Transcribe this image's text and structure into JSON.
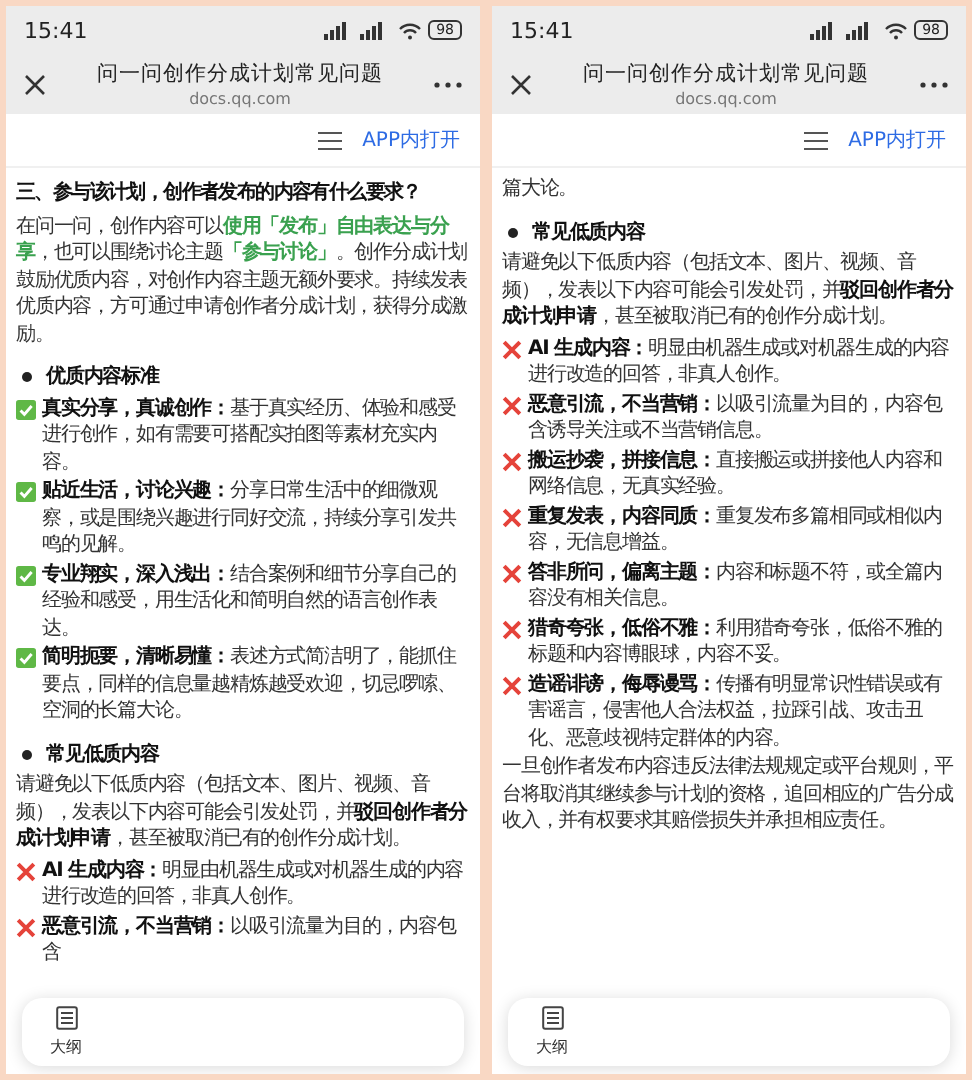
{
  "screens": [
    {
      "status_bar": {
        "time": "15:41",
        "battery": "98"
      },
      "header": {
        "title": "问一问创作分成计划常见问题",
        "url": "docs.qq.com"
      },
      "toolbar": {
        "open_in_app": "APP内打开"
      },
      "blocks": [
        {
          "kind": "heading",
          "text": "三、参与该计划，创作者发布的内容有什么要求？"
        },
        {
          "kind": "paragraph",
          "highlight": true,
          "text": "在问一问，创作内容可以**使用「发布」自由表达与分享**，也可以围绕讨论主题**「参与讨论」**。创作分成计划鼓励优质内容，对创作内容主题无额外要求。持续发表优质内容，方可通过申请创作者分成计划，获得分成激励。"
        },
        {
          "kind": "bullet",
          "text": "优质内容标准"
        },
        {
          "kind": "check",
          "text": "**真实分享，真诚创作：**基于真实经历、体验和感受进行创作，如有需要可搭配实拍图等素材充实内容。"
        },
        {
          "kind": "check",
          "text": "**贴近生活，讨论兴趣：**分享日常生活中的细微观察，或是围绕兴趣进行同好交流，持续分享引发共鸣的见解。"
        },
        {
          "kind": "check",
          "text": "**专业翔实，深入浅出：**结合案例和细节分享自己的经验和感受，用生活化和简明自然的语言创作表达。"
        },
        {
          "kind": "check",
          "text": "**简明扼要，清晰易懂：**表述方式简洁明了，能抓住要点，同样的信息量越精炼越受欢迎，切忌啰嗦、空洞的长篇大论。"
        },
        {
          "kind": "bullet",
          "text": "常见低质内容"
        },
        {
          "kind": "paragraph",
          "highlight": false,
          "text": "请避免以下低质内容（包括文本、图片、视频、音频），发表以下内容可能会引发处罚，并**驳回创作者分成计划申请**，甚至被取消已有的创作分成计划。"
        },
        {
          "kind": "cross",
          "text": "**AI 生成内容：**明显由机器生成或对机器生成的内容进行改造的回答，非真人创作。"
        },
        {
          "kind": "cross",
          "text": "**恶意引流，不当营销：**以吸引流量为目的，内容包含"
        }
      ],
      "outline": {
        "label": "大纲"
      }
    },
    {
      "status_bar": {
        "time": "15:41",
        "battery": "98"
      },
      "header": {
        "title": "问一问创作分成计划常见问题",
        "url": "docs.qq.com"
      },
      "toolbar": {
        "open_in_app": "APP内打开"
      },
      "blocks": [
        {
          "kind": "paragraph",
          "text": "篇大论。"
        },
        {
          "kind": "bullet",
          "text": "常见低质内容"
        },
        {
          "kind": "paragraph",
          "highlight": false,
          "text": "请避免以下低质内容（包括文本、图片、视频、音频），发表以下内容可能会引发处罚，并**驳回创作者分成计划申请**，甚至被取消已有的创作分成计划。"
        },
        {
          "kind": "cross",
          "text": "**AI 生成内容：**明显由机器生成或对机器生成的内容进行改造的回答，非真人创作。"
        },
        {
          "kind": "cross",
          "text": "**恶意引流，不当营销：**以吸引流量为目的，内容包含诱导关注或不当营销信息。"
        },
        {
          "kind": "cross",
          "text": "**搬运抄袭，拼接信息：**直接搬运或拼接他人内容和网络信息，无真实经验。"
        },
        {
          "kind": "cross",
          "text": "**重复发表，内容同质：**重复发布多篇相同或相似内容，无信息增益。"
        },
        {
          "kind": "cross",
          "text": "**答非所问，偏离主题：**内容和标题不符，或全篇内容没有相关信息。"
        },
        {
          "kind": "cross",
          "text": "**猎奇夸张，低俗不雅：**利用猎奇夸张，低俗不雅的标题和内容博眼球，内容不妥。"
        },
        {
          "kind": "cross",
          "text": "**造谣诽谤，侮辱谩骂：**传播有明显常识性错误或有害谣言，侵害他人合法权益，拉踩引战、攻击丑化、恶意歧视特定群体的内容。"
        },
        {
          "kind": "paragraph",
          "text": "一旦创作者发布内容违反法律法规规定或平台规则，平台将取消其继续参与计划的资格，追回相应的广告分成收入，并有权要求其赔偿损失并承担相应责任。"
        }
      ],
      "outline": {
        "label": "大纲"
      }
    }
  ]
}
